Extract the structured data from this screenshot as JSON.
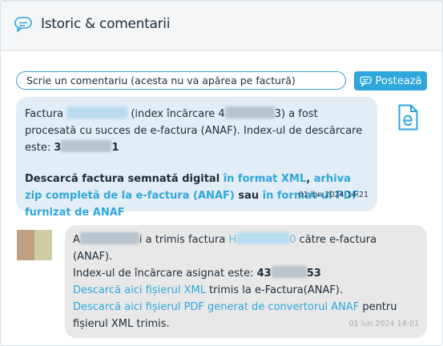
{
  "header": {
    "title": "Istoric & comentarii",
    "icon": "chat-comments-icon"
  },
  "composer": {
    "placeholder": "Scrie un comentariu (acesta nu va apărea pe factură)",
    "post_label": "Postează",
    "post_icon": "comment-icon"
  },
  "messages": [
    {
      "icon": "e-factura-document-icon",
      "p1": "Factura ",
      "p2": " (index încărcare 4",
      "p3": "3) a fost procesată cu succes de e-factura (ANAF). Index-ul de descărcare este: ",
      "p4": "3",
      "p5": "1",
      "d1": "Descarcă factura semnată digital ",
      "d2": "în format XML",
      "d3": ", ",
      "d4": "arhiva zip completă de la e-factura (ANAF)",
      "d5": " sau ",
      "d6": "în format-ul PDF furnizat de ANAF",
      "time": "01 lun 2024 14:21"
    },
    {
      "author_prefix": "A",
      "author_suffix": "i a trimis factura ",
      "invoice_prefix": "H",
      "invoice_suffix": "0",
      "send_rest": " către e-factura (ANAF).",
      "index_label": "Index-ul de încărcare asignat este: ",
      "index_prefix": "43",
      "index_suffix": "53",
      "link1": "Descarcă aici fișierul XML",
      "link1_rest": " trimis la e-Factura(ANAF).",
      "link2": "Descarcă aici fișierul PDF generat de convertorul ANAF",
      "link2_rest": " pentru fișierul XML trimis.",
      "time": "01 lun 2024 14:01"
    }
  ],
  "colors": {
    "accent": "#2ea7dc",
    "bubble_system": "#e3edf6",
    "bubble_user": "#e8e8e8",
    "header_bg": "#f4f6f8"
  }
}
